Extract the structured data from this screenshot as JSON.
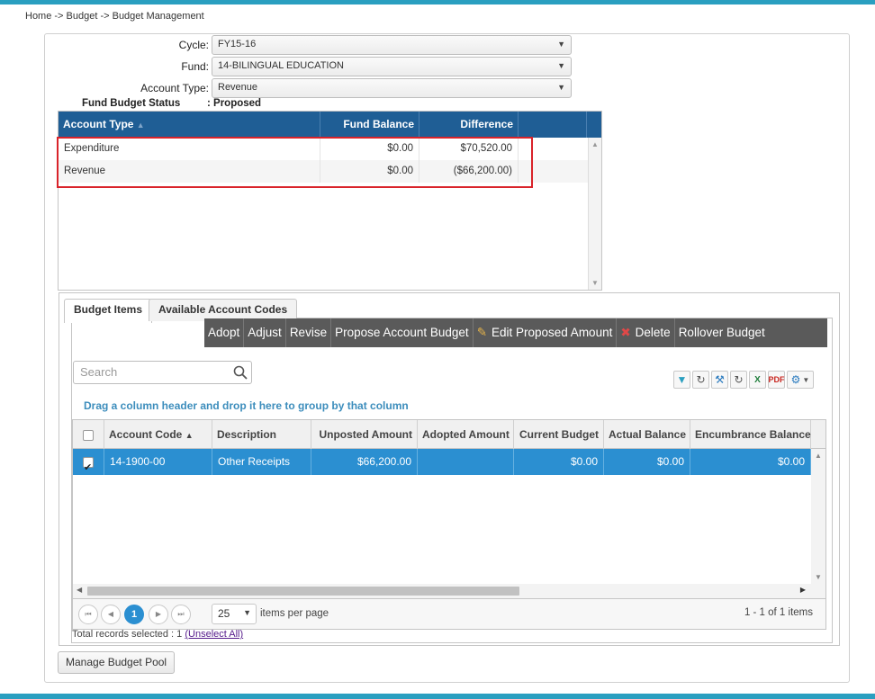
{
  "breadcrumb": "Home -> Budget -> Budget Management",
  "form": {
    "cycle_label": "Cycle:",
    "cycle_value": "FY15-16",
    "fund_label": "Fund:",
    "fund_value": "14-BILINGUAL EDUCATION",
    "account_type_label": "Account Type:",
    "account_type_value": "Revenue",
    "status_label": "Fund Budget Status",
    "status_value": ": Proposed"
  },
  "fund_grid": {
    "columns": [
      "Account Type",
      "Fund Balance",
      "Difference"
    ],
    "rows": [
      {
        "type": "Expenditure",
        "fund_balance": "$0.00",
        "difference": "$70,520.00"
      },
      {
        "type": "Revenue",
        "fund_balance": "$0.00",
        "difference": "($66,200.00)"
      }
    ]
  },
  "tabs": [
    "Budget Items",
    "Available Account Codes"
  ],
  "toolbar": [
    "Adopt",
    "Adjust",
    "Revise",
    "Propose Account Budget",
    "Edit Proposed Amount",
    "Delete",
    "Rollover Budget"
  ],
  "search": {
    "placeholder": "Search"
  },
  "group_hint": "Drag a column header and drop it here to group by that column",
  "items_grid": {
    "columns": [
      "Account Code",
      "Description",
      "Unposted Amount",
      "Adopted Amount",
      "Current Budget",
      "Actual Balance",
      "Encumbrance Balance"
    ],
    "rows": [
      {
        "checked": true,
        "account_code": "14-1900-00",
        "description": "Other Receipts",
        "unposted": "$66,200.00",
        "adopted": "",
        "current": "$0.00",
        "actual": "$0.00",
        "encumbrance": "$0.00"
      }
    ]
  },
  "pager": {
    "current_page": "1",
    "page_size": "25",
    "per_page_label": "items per page",
    "info": "1 - 1 of 1 items"
  },
  "total_selected": "Total records selected : 1",
  "unselect_all": "(Unselect All)",
  "manage_button": "Manage Budget Pool",
  "colors": {
    "accent": "#2a9fc0",
    "header_blue": "#1f5e95",
    "selected_row": "#2b8fd1",
    "toolbar": "#5a5a5a",
    "highlight": "#d9232a"
  }
}
